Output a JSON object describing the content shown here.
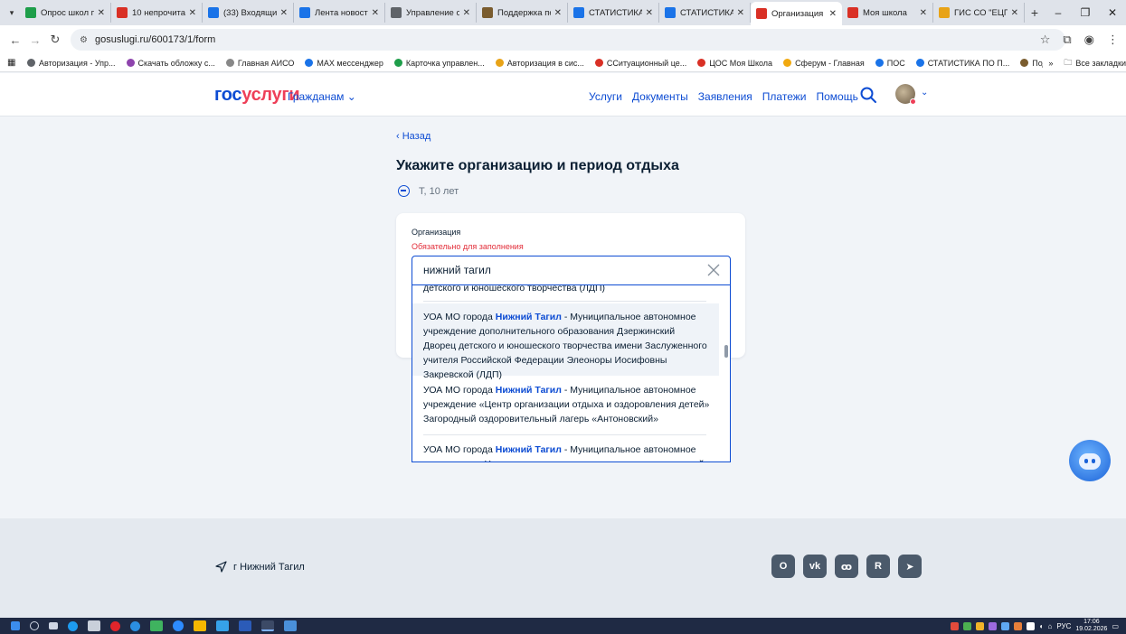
{
  "browser": {
    "tabs": [
      {
        "title": "Опрос школ п",
        "favicon_color": "#1e9e4a"
      },
      {
        "title": "10 непрочитан",
        "favicon_color": "#d93025"
      },
      {
        "title": "(33) Входящие",
        "favicon_color": "#1a73e8"
      },
      {
        "title": "Лента новосте",
        "favicon_color": "#1a73e8"
      },
      {
        "title": "Управление о",
        "favicon_color": "#5f6368"
      },
      {
        "title": "Поддержка по",
        "favicon_color": "#7a5c2e"
      },
      {
        "title": "СТАТИСТИКА",
        "favicon_color": "#1a73e8"
      },
      {
        "title": "СТАТИСТИКА",
        "favicon_color": "#1a73e8"
      },
      {
        "title": "Организация",
        "favicon_color": "#d93025",
        "active": true
      },
      {
        "title": "Моя школа",
        "favicon_color": "#d93025"
      },
      {
        "title": "ГИС СО \"ЕЦП\"",
        "favicon_color": "#e8a317"
      }
    ],
    "new_tab": "+",
    "url": "gosuslugi.ru/600173/1/form",
    "bookmarks": [
      {
        "label": "Авторизация - Упр...",
        "color": "#5f6368"
      },
      {
        "label": "Скачать обложку с...",
        "color": "#8e44ad"
      },
      {
        "label": "Главная АИСО",
        "color": "#888888"
      },
      {
        "label": "MAX мессенджер",
        "color": "#1a73e8"
      },
      {
        "label": "Карточка управлен...",
        "color": "#1e9e4a"
      },
      {
        "label": "Авторизация в сис...",
        "color": "#e8a317"
      },
      {
        "label": "ССитуационный це...",
        "color": "#d93025"
      },
      {
        "label": "ЦОС Моя Школа",
        "color": "#d93025"
      },
      {
        "label": "Сферум - Главная",
        "color": "#f1a90f"
      },
      {
        "label": "ПОС",
        "color": "#1a73e8"
      },
      {
        "label": "СТАТИСТИКА ПО П...",
        "color": "#1a73e8"
      },
      {
        "label": "Поддержка пользо...",
        "color": "#7a5c2e"
      }
    ],
    "bookmarks_more": "»",
    "all_bookmarks": "Все закладки"
  },
  "header": {
    "logo_part1": "гос",
    "logo_part2": "услуги",
    "citizens": "Гражданам",
    "nav": [
      "Услуги",
      "Документы",
      "Заявления",
      "Платежи",
      "Помощь"
    ]
  },
  "content": {
    "back": "Назад",
    "title": "Укажите организацию и период отдыха",
    "child": "Т, 10 лет",
    "field_label": "Организация",
    "field_required": "Обязательно для заполнения",
    "search_value": "нижний тагил",
    "options": [
      {
        "pre": "",
        "match": "",
        "post": "детского и юношеского творчества (ЛДП)"
      },
      {
        "pre": "УОА МО города ",
        "match": "Нижний Тагил",
        "post": " - Муниципальное автономное учреждение дополнительного образования Дзержинский Дворец детского и юношеского творчества имени Заслуженного учителя Российской Федерации Элеоноры Иосифовны Закревской (ЛДП)"
      },
      {
        "pre": "УОА МО города ",
        "match": "Нижний Тагил",
        "post": " - Муниципальное автономное учреждение «Центр организации отдыха и оздоровления детей» Загородный оздоровительный лагерь «Антоновский»"
      },
      {
        "pre": "УОА МО города ",
        "match": "Нижний Тагил",
        "post": " - Муниципальное автономное учреждение «Центр организации отдыха и оздоровления детей»"
      }
    ]
  },
  "footer": {
    "region": "г Нижний Тагил",
    "socials": [
      "ok",
      "vk",
      "ok-ru",
      "rutube",
      "telegram"
    ]
  },
  "taskbar": {
    "time": "17:06",
    "date": "19.02.2026",
    "lang": "РУС"
  },
  "colors": {
    "accent": "#0d4cd3",
    "brand_red": "#ee3f58",
    "error": "#e22c38",
    "page_bg": "#f1f4f8"
  }
}
